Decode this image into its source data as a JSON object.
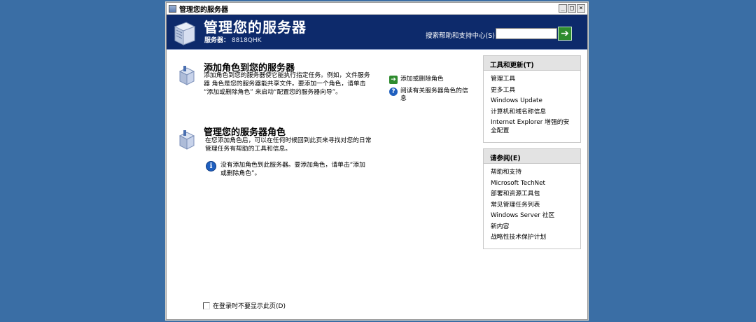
{
  "window": {
    "title": "管理您的服务器",
    "minimize": "_",
    "maximize": "□",
    "close": "×"
  },
  "header": {
    "title": "管理您的服务器",
    "server_label": "服务器：",
    "server_name": "8818QHK",
    "help_label": "搜索帮助和支持中心(S)",
    "help_placeholder": "",
    "go_label": "➔"
  },
  "sections": [
    {
      "title": "添加角色到您的服务器",
      "desc": [
        "添加角色到您的服务器使它能执行指定任务。例如，文件服务",
        "器 角色是您的服务器能共享文件。要添加一个角色，请单击",
        "“添加或删除角色” 来启动“配置您的服务器向导”。"
      ]
    },
    {
      "title": "管理您的服务器角色",
      "desc": [
        "在您添加角色后，可以在任何时候回到此页来寻找对您的日常",
        "管理任务有帮助的工具和信息。"
      ],
      "info": [
        "没有添加角色到此服务器。要添加角色，请单击“添加",
        "或删除角色”。"
      ]
    }
  ],
  "actions": [
    {
      "label": [
        "添加或删除角色"
      ]
    },
    {
      "label": [
        "阅读有关服务器角色的信",
        "息"
      ]
    }
  ],
  "panels": [
    {
      "title": "工具和更新(T)",
      "items": [
        "管理工具",
        "更多工具",
        "Windows Update",
        "计算机和域名称信息",
        "Internet Explorer 增强的安全配置"
      ]
    },
    {
      "title": "请参阅(E)",
      "items": [
        "帮助和支持",
        "Microsoft TechNet",
        "部署和资源工具包",
        "常见管理任务列表",
        "Windows Server 社区",
        "新内容",
        "战略性技术保护计划"
      ]
    }
  ],
  "footer": {
    "checkbox_label": "在登录时不要显示此页(D)",
    "checked": false
  },
  "colors": {
    "header_bg": "#0d2a6b",
    "desktop_bg": "#3a6ea5",
    "go_green": "#2e8b2e"
  }
}
